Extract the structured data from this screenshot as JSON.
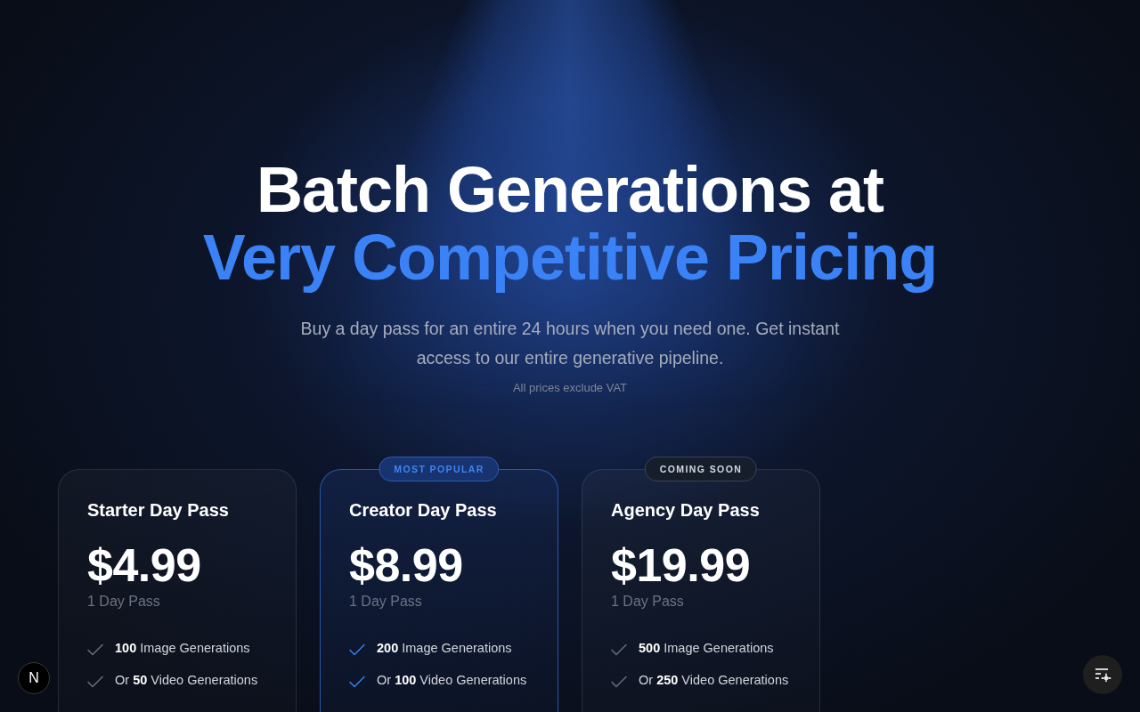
{
  "hero": {
    "title_line_1": "Batch Generations at",
    "title_line_2": "Very Competitive Pricing",
    "subtitle": "Buy a day pass for an entire 24 hours when you need one. Get instant access to our entire generative pipeline.",
    "note": "All prices exclude VAT"
  },
  "plans": [
    {
      "name": "Starter Day Pass",
      "price": "$4.99",
      "period": "1 Day Pass",
      "highlighted": false,
      "features": [
        "**100** Image Generations",
        "Or **50** Video Generations"
      ]
    },
    {
      "badge": {
        "kind": "popular",
        "label": "MOST POPULAR"
      },
      "name": "Creator Day Pass",
      "price": "$8.99",
      "period": "1 Day Pass",
      "highlighted": true,
      "features": [
        "**200** Image Generations",
        "Or **100** Video Generations"
      ]
    },
    {
      "badge": {
        "kind": "soon",
        "label": "COMING SOON"
      },
      "name": "Agency Day Pass",
      "price": "$19.99",
      "period": "1 Day Pass",
      "highlighted": false,
      "features": [
        "**500** Image Generations",
        "Or **250** Video Generations"
      ]
    }
  ],
  "logo_button": {
    "label": "N"
  }
}
